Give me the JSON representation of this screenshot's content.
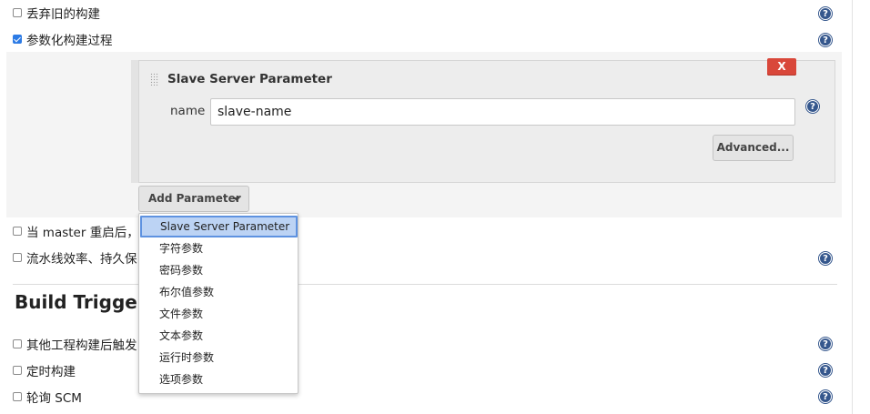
{
  "options": {
    "discard_old_builds": {
      "label": "丢弃旧的构建",
      "checked": false
    },
    "parameterized": {
      "label": "参数化构建过程",
      "checked": true
    },
    "master_restart": {
      "label": "当 master 重启后，",
      "checked": false
    },
    "pipeline_durability": {
      "label": "流水线效率、持久保",
      "checked": false
    }
  },
  "parameter": {
    "title": "Slave Server Parameter",
    "delete_label": "X",
    "name_label": "name",
    "name_value": "slave-name",
    "advanced_label": "Advanced..."
  },
  "add_parameter": {
    "label": "Add Parameter"
  },
  "menu": {
    "items": [
      {
        "label": "Slave Server Parameter",
        "selected": true
      },
      {
        "label": "字符参数"
      },
      {
        "label": "密码参数"
      },
      {
        "label": "布尔值参数"
      },
      {
        "label": "文件参数"
      },
      {
        "label": "文本参数"
      },
      {
        "label": "运行时参数"
      },
      {
        "label": "选项参数"
      }
    ]
  },
  "build_triggers": {
    "title": "Build Triggers",
    "items": [
      {
        "label": "其他工程构建后触发",
        "checked": false
      },
      {
        "label": "定时构建",
        "checked": false
      },
      {
        "label": "轮询 SCM",
        "checked": false
      }
    ]
  },
  "help_icon_glyph": "?",
  "colors": {
    "accent": "#2d7be5",
    "delete": "#d9473a",
    "help": "#35578d",
    "menu_highlight": "#bcd3f4"
  }
}
